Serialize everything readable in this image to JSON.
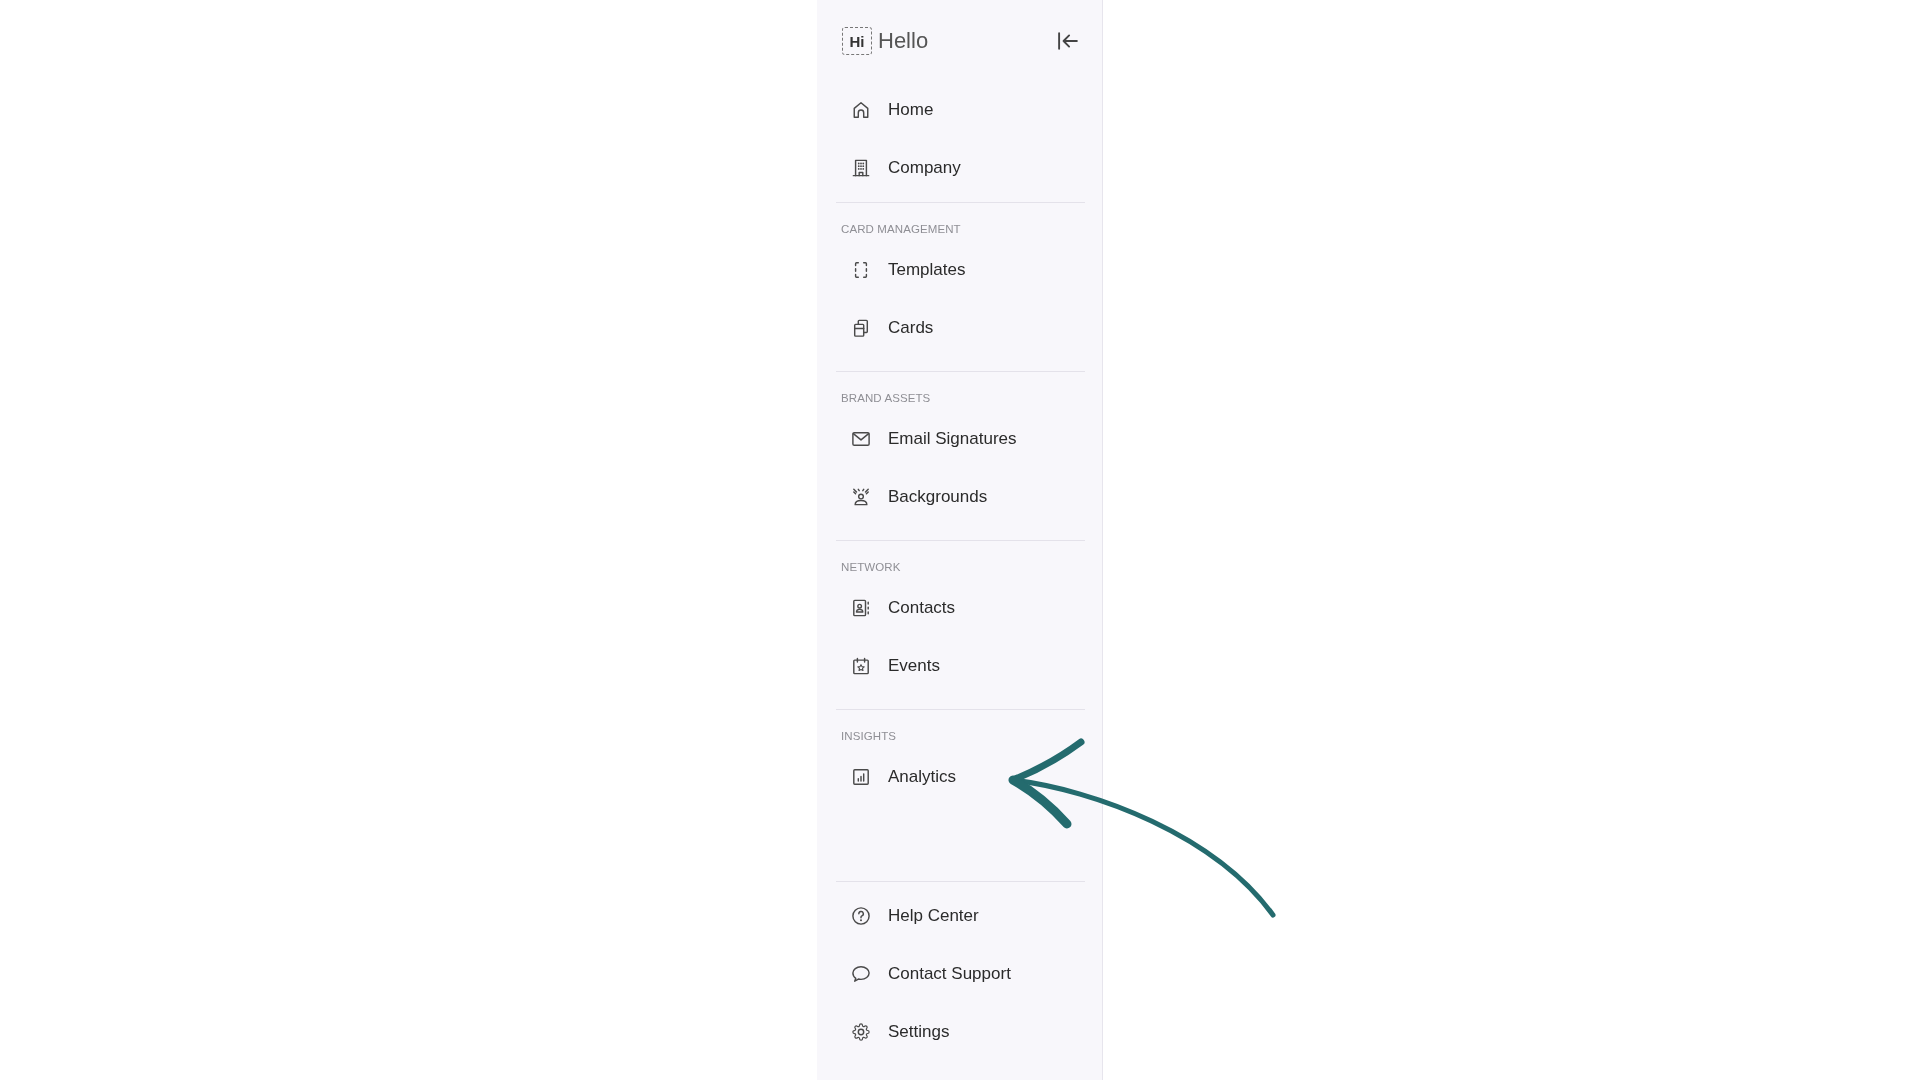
{
  "sidebar": {
    "logo": {
      "mark": "Hi",
      "name": "Hello"
    },
    "sections": [
      {
        "items": [
          {
            "label": "Home",
            "selected": false
          },
          {
            "label": "Company",
            "selected": false
          }
        ]
      },
      {
        "title": "CARD MANAGEMENT",
        "items": [
          {
            "label": "Templates",
            "selected": false
          },
          {
            "label": "Cards",
            "selected": false
          }
        ]
      },
      {
        "title": "BRAND ASSETS",
        "items": [
          {
            "label": "Email Signatures",
            "selected": false
          },
          {
            "label": "Backgrounds",
            "selected": false
          }
        ]
      },
      {
        "title": "NETWORK",
        "items": [
          {
            "label": "Contacts",
            "selected": false
          },
          {
            "label": "Events",
            "selected": false
          }
        ]
      },
      {
        "title": "INSIGHTS",
        "items": [
          {
            "label": "Analytics",
            "selected": false
          }
        ]
      }
    ],
    "footer_items": [
      {
        "label": "Help Center",
        "selected": false
      },
      {
        "label": "Contact Support",
        "selected": false
      },
      {
        "label": "Settings",
        "selected": false
      }
    ]
  }
}
